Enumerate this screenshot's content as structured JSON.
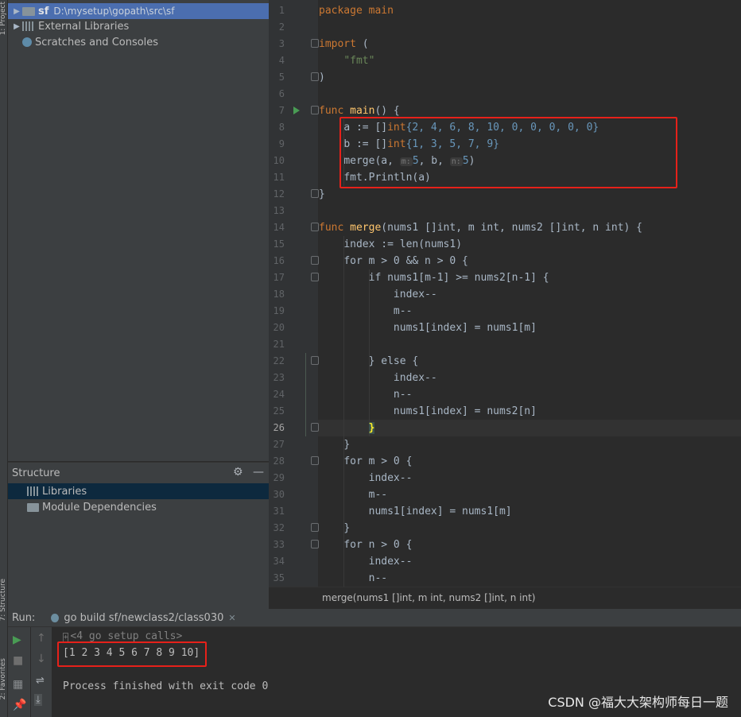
{
  "left_strip": {
    "labels": [
      "1: Project",
      "7: Structure",
      "2: Favorites"
    ]
  },
  "project_tree": {
    "items": [
      {
        "name": "sf",
        "path": "D:\\mysetup\\gopath\\src\\sf"
      },
      {
        "name": "External Libraries"
      },
      {
        "name": "Scratches and Consoles"
      }
    ]
  },
  "structure": {
    "title": "Structure",
    "items": [
      "Libraries",
      "Module Dependencies"
    ]
  },
  "editor": {
    "current_line": 26,
    "lines": [
      {
        "n": "1"
      },
      {
        "n": "2"
      },
      {
        "n": "3"
      },
      {
        "n": "4"
      },
      {
        "n": "5"
      },
      {
        "n": "6"
      },
      {
        "n": "7"
      },
      {
        "n": "8"
      },
      {
        "n": "9"
      },
      {
        "n": "10"
      },
      {
        "n": "11"
      },
      {
        "n": "12"
      },
      {
        "n": "13"
      },
      {
        "n": "14"
      },
      {
        "n": "15"
      },
      {
        "n": "16"
      },
      {
        "n": "17"
      },
      {
        "n": "18"
      },
      {
        "n": "19"
      },
      {
        "n": "20"
      },
      {
        "n": "21"
      },
      {
        "n": "22"
      },
      {
        "n": "23"
      },
      {
        "n": "24"
      },
      {
        "n": "25"
      },
      {
        "n": "26"
      },
      {
        "n": "27"
      },
      {
        "n": "28"
      },
      {
        "n": "29"
      },
      {
        "n": "30"
      },
      {
        "n": "31"
      },
      {
        "n": "32"
      },
      {
        "n": "33"
      },
      {
        "n": "34"
      },
      {
        "n": "35"
      }
    ],
    "code": {
      "l1": "package main",
      "l3_kw": "import",
      "l3_rest": " (",
      "l4_str": "\"fmt\"",
      "l5": ")",
      "l7_kw": "func",
      "l7_fn": "main",
      "l7_rest": "() {",
      "l8_a": "a := []",
      "l8_kw": "int",
      "l8_nums": "{2, 4, 6, 8, 10, 0, 0, 0, 0, 0}",
      "l9_a": "b := []",
      "l9_kw": "int",
      "l9_nums": "{1, 3, 5, 7, 9}",
      "l10_call": "merge(a, ",
      "l10_hint_m": "m:",
      "l10_m": "5",
      "l10_mid": ", b, ",
      "l10_hint_n": "n:",
      "l10_n": "5",
      "l10_end": ")",
      "l11": "fmt.Println(a)",
      "l12": "}",
      "l14_kw": "func",
      "l14_fn": "merge",
      "l14_sig": "(nums1 []int, m int, nums2 []int, n int) {",
      "l15": "index := len(nums1)",
      "l16": "for m > 0 && n > 0 {",
      "l17": "if nums1[m-1] >= nums2[n-1] {",
      "l18": "index--",
      "l19": "m--",
      "l20": "nums1[index] = nums1[m]",
      "l22": "} else {",
      "l23": "index--",
      "l24": "n--",
      "l25": "nums1[index] = nums2[n]",
      "l26": "}",
      "l27": "}",
      "l28": "for m > 0 {",
      "l29": "index--",
      "l30": "m--",
      "l31": "nums1[index] = nums1[m]",
      "l32": "}",
      "l33": "for n > 0 {",
      "l34": "index--",
      "l35": "n--"
    }
  },
  "status_bar": {
    "signature": "merge(nums1 []int, m int, nums2 []int, n int)"
  },
  "run_panel": {
    "label": "Run:",
    "tab": "go build sf/newclass2/class030",
    "lines": [
      "<4 go setup calls>",
      "[1 2 3 4 5 6 7 8 9 10]",
      "Process finished with exit code 0"
    ]
  },
  "watermark": "CSDN @福大大架构师每日一题",
  "colors": {
    "keyword": "#cc7832",
    "function": "#ffc66d",
    "string": "#6a8759",
    "number": "#6897bb",
    "highlight_box": "#e6211a"
  }
}
